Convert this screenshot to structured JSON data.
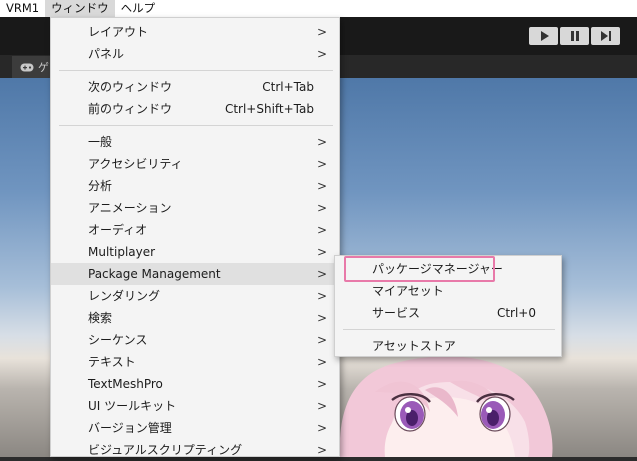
{
  "menubar": {
    "items": [
      "VRM1",
      "ウィンドウ",
      "ヘルプ"
    ]
  },
  "toolbar": {
    "play_icon": "play-icon",
    "pause_icon": "pause-icon",
    "step_icon": "step-icon"
  },
  "tabs": {
    "game_label": "ゲ"
  },
  "window_menu": {
    "items": [
      {
        "label": "レイアウト",
        "submenu": true
      },
      {
        "label": "パネル",
        "submenu": true
      },
      {
        "label": "次のウィンドウ",
        "shortcut": "Ctrl+Tab"
      },
      {
        "label": "前のウィンドウ",
        "shortcut": "Ctrl+Shift+Tab"
      },
      {
        "label": "一般",
        "submenu": true
      },
      {
        "label": "アクセシビリティ",
        "submenu": true
      },
      {
        "label": "分析",
        "submenu": true
      },
      {
        "label": "アニメーション",
        "submenu": true
      },
      {
        "label": "オーディオ",
        "submenu": true
      },
      {
        "label": "Multiplayer",
        "submenu": true
      },
      {
        "label": "Package Management",
        "submenu": true
      },
      {
        "label": "レンダリング",
        "submenu": true
      },
      {
        "label": "検索",
        "submenu": true
      },
      {
        "label": "シーケンス",
        "submenu": true
      },
      {
        "label": "テキスト",
        "submenu": true
      },
      {
        "label": "TextMeshPro",
        "submenu": true
      },
      {
        "label": "UI ツールキット",
        "submenu": true
      },
      {
        "label": "バージョン管理",
        "submenu": true
      },
      {
        "label": "ビジュアルスクリプティング",
        "submenu": true
      }
    ],
    "arrow": ">"
  },
  "package_submenu": {
    "items": [
      {
        "label": "パッケージマネージャー"
      },
      {
        "label": "マイアセット"
      },
      {
        "label": "サービス",
        "shortcut": "Ctrl+0"
      },
      {
        "label": "アセットストア"
      }
    ]
  },
  "colors": {
    "highlight_border": "#e879a9",
    "menu_bg": "#f4f4f4",
    "toolbar_bg": "#191919"
  }
}
